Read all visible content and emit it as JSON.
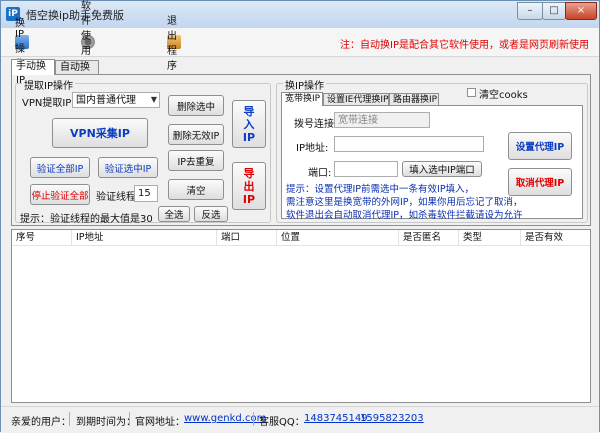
{
  "window": {
    "title": "悟空换ip助手免费版",
    "minimize": "–",
    "maximize": "□",
    "close": "×"
  },
  "toolbar": {
    "items": [
      {
        "label": "换IP操作",
        "icon": "switch-ip-icon"
      },
      {
        "label": "软件使用指南",
        "icon": "gear-icon"
      },
      {
        "label": "退出程序",
        "icon": "exit-icon"
      }
    ],
    "notice": "注：自动换IP是配合其它软件使用，或者是网页刷新使用"
  },
  "tabs": [
    "手动换IP",
    "自动换IP"
  ],
  "fetch_group": {
    "legend": "提取IP操作",
    "vpn_label": "VPN提取IP",
    "vpn_select": "国内普通代理",
    "vpn_collect": "VPN采集IP",
    "delete_selected": "删除选中",
    "delete_invalid": "删除无效IP",
    "ip_dedupe": "IP去重复",
    "clear": "清空",
    "import_ip": "导入IP",
    "export_ip": "导出IP",
    "verify_all": "验证全部IP",
    "verify_selected": "验证选中IP",
    "stop_verify": "停止验证全部",
    "threads_label": "验证线程",
    "threads_value": "15",
    "select_all": "全选",
    "invert": "反选",
    "hint": "提示：验证线程的最大值是30"
  },
  "switch_group": {
    "legend": "换IP操作",
    "clear_cookies": "清空cooks",
    "subtabs": [
      "宽带换IP",
      "设置IE代理换IP",
      "路由器换IP"
    ],
    "dial_label": "拨号连接",
    "dial_value": "宽带连接",
    "ip_label": "IP地址:",
    "ip_value": "",
    "port_label": "端口:",
    "port_value": "",
    "fill_selected": "填入选中IP端口",
    "set_proxy": "设置代理IP",
    "cancel_proxy": "取消代理IP",
    "hint_lines": [
      "提示：设置代理IP前需选中一条有效IP填入，",
      "需注意这里是换宽带的外网IP，如果你用后忘记了取消，",
      "软件退出会自动取消代理IP，如杀毒软件拦截请设为允许"
    ]
  },
  "table": {
    "columns": [
      "序号",
      "IP地址",
      "端口",
      "位置",
      "是否匿名",
      "类型",
      "是否有效"
    ],
    "rows": []
  },
  "statusbar": {
    "user_label": "亲爱的用户：",
    "expiry_label": "到期时间为：",
    "site_label": "官网地址：",
    "site_url": "www.genkd.com",
    "qq_label": "客服QQ：",
    "qq1": "1483745149",
    "qq2": "1595823203"
  },
  "colors": {
    "notice_red": "#e00000",
    "button_blue": "#0b3cc2",
    "link_blue": "#0033cc"
  }
}
